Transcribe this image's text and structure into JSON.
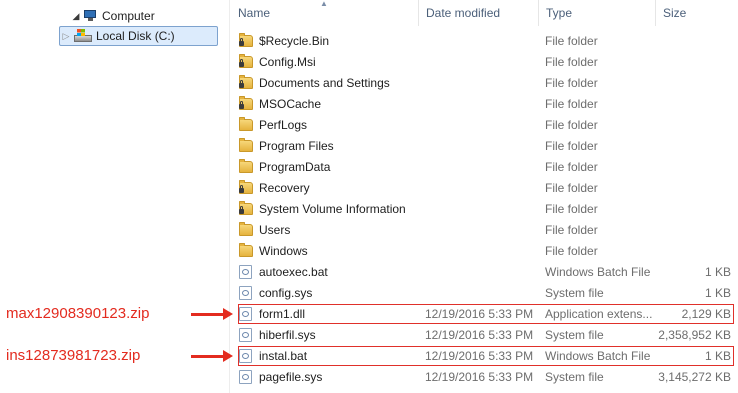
{
  "nav": {
    "computer": "Computer",
    "local_disk": "Local Disk (C:)"
  },
  "columns": {
    "name": "Name",
    "date": "Date modified",
    "type": "Type",
    "size": "Size"
  },
  "files": [
    {
      "name": "$Recycle.Bin",
      "date": "",
      "type": "File folder",
      "size": "",
      "icon": "folder-icon",
      "locked": true
    },
    {
      "name": "Config.Msi",
      "date": "",
      "type": "File folder",
      "size": "",
      "icon": "folder-icon",
      "locked": true
    },
    {
      "name": "Documents and Settings",
      "date": "",
      "type": "File folder",
      "size": "",
      "icon": "folder-icon",
      "locked": true
    },
    {
      "name": "MSOCache",
      "date": "",
      "type": "File folder",
      "size": "",
      "icon": "folder-icon",
      "locked": true
    },
    {
      "name": "PerfLogs",
      "date": "",
      "type": "File folder",
      "size": "",
      "icon": "folder-icon",
      "locked": false
    },
    {
      "name": "Program Files",
      "date": "",
      "type": "File folder",
      "size": "",
      "icon": "folder-icon",
      "locked": false
    },
    {
      "name": "ProgramData",
      "date": "",
      "type": "File folder",
      "size": "",
      "icon": "folder-icon",
      "locked": false
    },
    {
      "name": "Recovery",
      "date": "",
      "type": "File folder",
      "size": "",
      "icon": "folder-icon",
      "locked": true
    },
    {
      "name": "System Volume Information",
      "date": "",
      "type": "File folder",
      "size": "",
      "icon": "folder-icon",
      "locked": true
    },
    {
      "name": "Users",
      "date": "",
      "type": "File folder",
      "size": "",
      "icon": "folder-icon",
      "locked": false
    },
    {
      "name": "Windows",
      "date": "",
      "type": "File folder",
      "size": "",
      "icon": "folder-icon",
      "locked": false
    },
    {
      "name": "autoexec.bat",
      "date": "",
      "type": "Windows Batch File",
      "size": "1 KB",
      "icon": "batch-file-icon",
      "locked": false
    },
    {
      "name": "config.sys",
      "date": "",
      "type": "System file",
      "size": "1 KB",
      "icon": "system-file-icon",
      "locked": false
    },
    {
      "name": "form1.dll",
      "date": "12/19/2016 5:33 PM",
      "type": "Application extens...",
      "size": "2,129 KB",
      "icon": "dll-file-icon",
      "locked": false,
      "highlighted": true
    },
    {
      "name": "hiberfil.sys",
      "date": "12/19/2016 5:33 PM",
      "type": "System file",
      "size": "2,358,952 KB",
      "icon": "system-file-icon",
      "locked": false
    },
    {
      "name": "instal.bat",
      "date": "12/19/2016 5:33 PM",
      "type": "Windows Batch File",
      "size": "1 KB",
      "icon": "batch-file-icon",
      "locked": false,
      "highlighted": true
    },
    {
      "name": "pagefile.sys",
      "date": "12/19/2016 5:33 PM",
      "type": "System file",
      "size": "3,145,272 KB",
      "icon": "system-file-icon",
      "locked": false
    }
  ],
  "annotations": [
    {
      "text": "max12908390123.zip",
      "target": "form1.dll"
    },
    {
      "text": "ins12873981723.zip",
      "target": "instal.bat"
    }
  ],
  "colors": {
    "annotation": "#e32b1f",
    "selection": "#dcebfc",
    "header_text": "#4c607a"
  }
}
